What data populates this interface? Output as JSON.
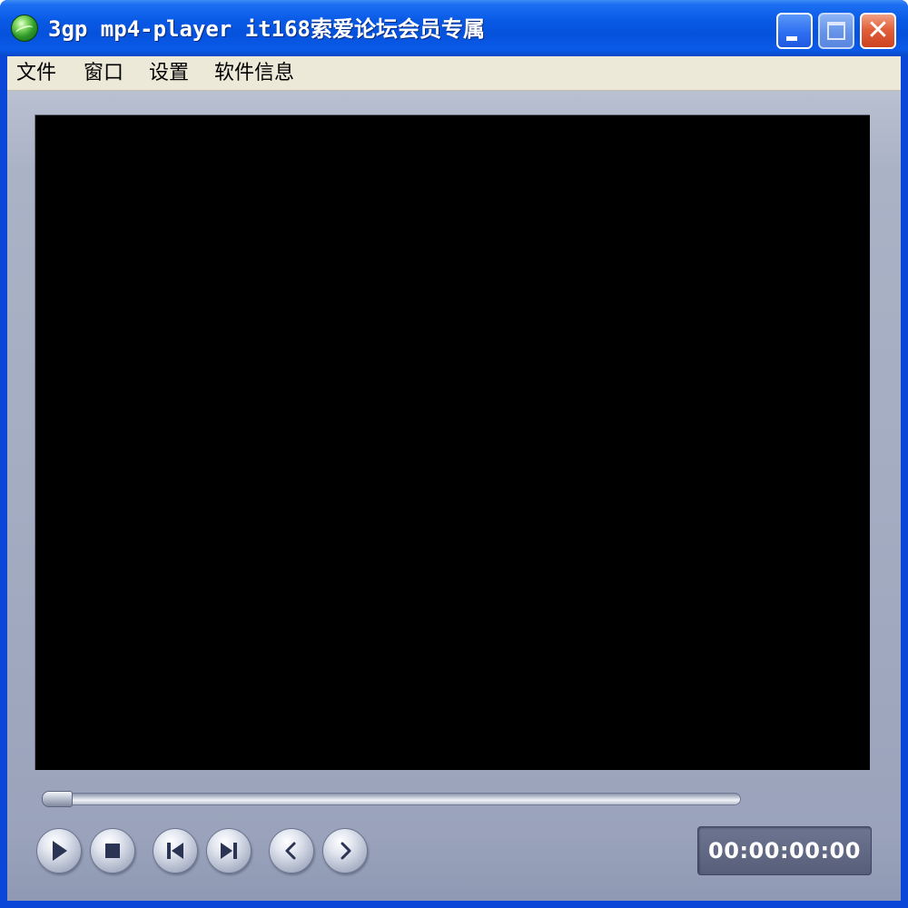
{
  "window": {
    "title": "3gp mp4-player it168索爱论坛会员专属",
    "app_icon": "sony-ericsson-globe-icon",
    "controls": {
      "minimize_icon": "minimize-icon",
      "maximize_icon": "maximize-icon",
      "close_icon": "close-icon",
      "close_glyph": "✕"
    }
  },
  "menu": {
    "items": [
      {
        "label": "文件"
      },
      {
        "label": "窗口"
      },
      {
        "label": "设置"
      },
      {
        "label": "软件信息"
      }
    ]
  },
  "player": {
    "seek_position": 0,
    "buttons": [
      {
        "name": "play-button",
        "icon": "play-icon"
      },
      {
        "name": "stop-button",
        "icon": "stop-icon"
      },
      {
        "name": "previous-button",
        "icon": "skip-back-icon"
      },
      {
        "name": "next-button",
        "icon": "skip-forward-icon"
      },
      {
        "name": "rewind-button",
        "icon": "chevron-left-icon"
      },
      {
        "name": "forward-button",
        "icon": "chevron-right-icon"
      }
    ],
    "time_display": "00:00:00:00"
  },
  "colors": {
    "titlebar": "#0552dc",
    "menubar": "#ece9d8",
    "player_body": "#a4acc2",
    "video_area": "#000000",
    "time_box": "#5f6784",
    "control_icon": "#2b3452"
  }
}
